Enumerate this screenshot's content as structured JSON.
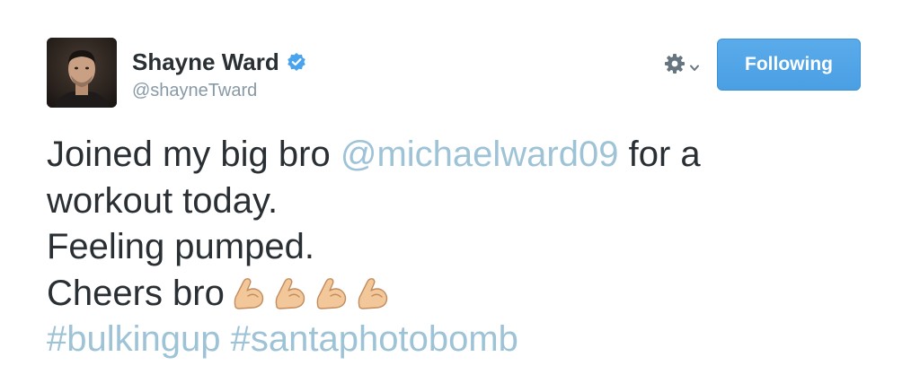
{
  "tweet": {
    "author": {
      "display_name": "Shayne Ward",
      "handle": "@shayneTward",
      "verified": true,
      "verified_icon": "verified-badge-icon"
    },
    "actions": {
      "settings_icon": "gear-icon",
      "follow_button_label": "Following",
      "follow_button_color": "#55acee"
    },
    "text": {
      "line1_prefix": "Joined my big bro ",
      "mention": "@michaelward09",
      "line1_suffix": " for a",
      "line2": "workout today.",
      "line3": "Feeling pumped.",
      "line4": "Cheers bro",
      "emoji": [
        "flexed-biceps",
        "flexed-biceps",
        "flexed-biceps",
        "flexed-biceps"
      ],
      "hashtag1": "#bulkingup",
      "hashtag2": "#santaphotobomb",
      "link_color": "#9ec3d6"
    }
  }
}
